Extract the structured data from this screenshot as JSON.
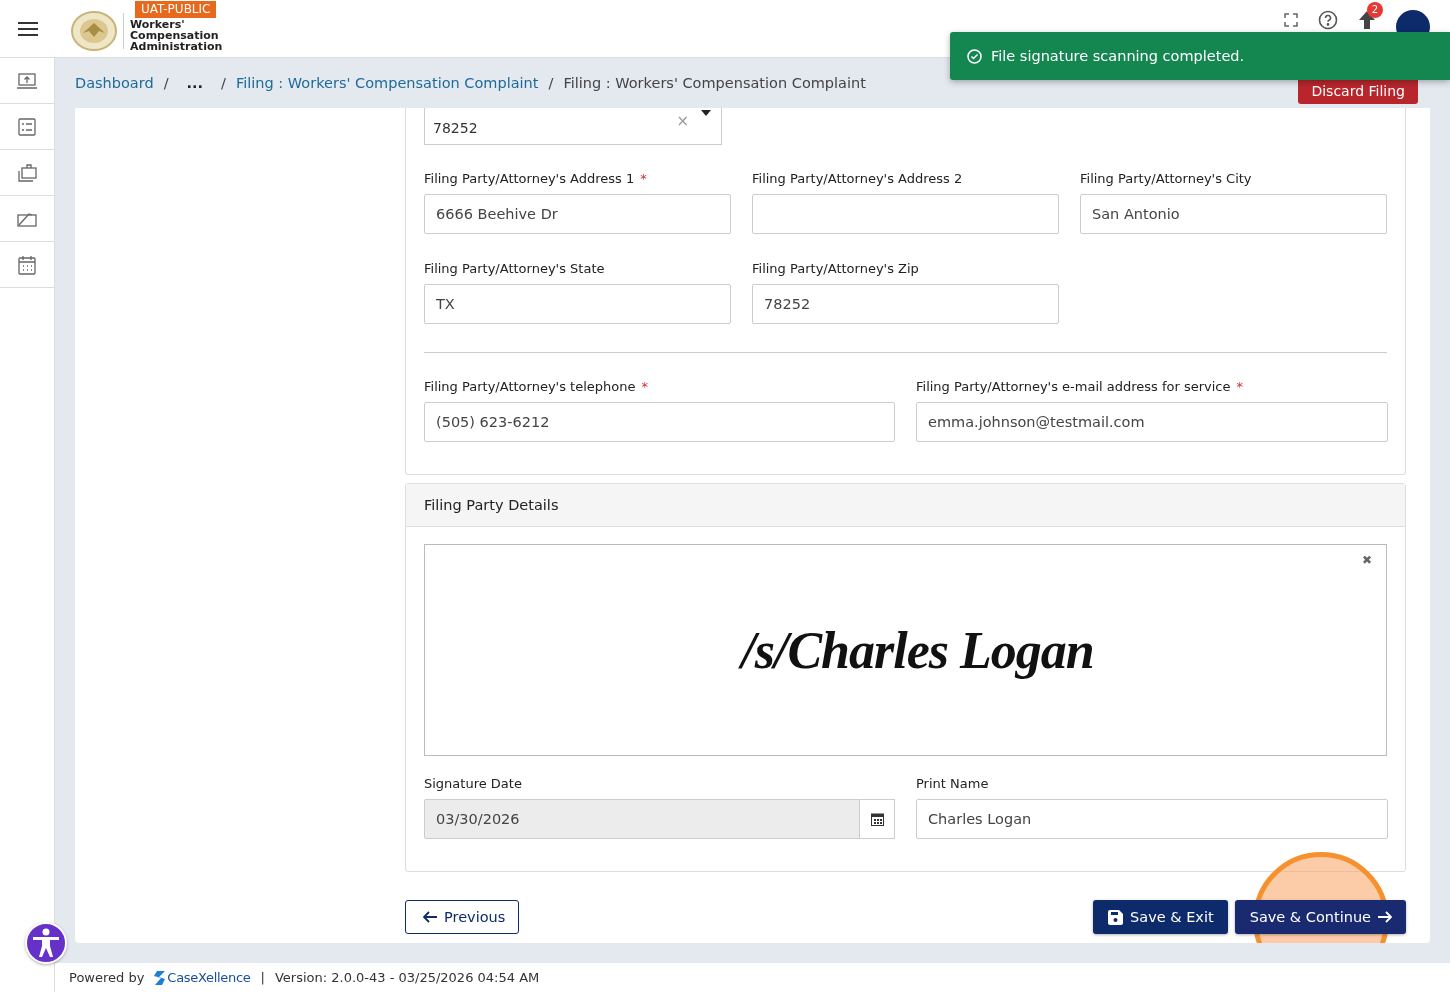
{
  "header": {
    "env_badge": "UAT-PUBLIC",
    "logo_lines": [
      "Workers'",
      "Compensation",
      "Administration"
    ],
    "notification_count": "2"
  },
  "sidebar": {
    "items": [
      {
        "kind": "upload"
      },
      {
        "kind": "list"
      },
      {
        "kind": "briefcase"
      },
      {
        "kind": "edit"
      },
      {
        "kind": "calendar"
      }
    ]
  },
  "breadcrumbs": [
    {
      "label": "Dashboard",
      "link": true
    },
    {
      "separator": "/",
      "label": "...",
      "link": false
    },
    {
      "separator": "/",
      "label": "Filing : Workers' Compensation Complaint",
      "link": true
    },
    {
      "separator": "/",
      "label": "Filing : Workers' Compensation Complaint",
      "link": false
    }
  ],
  "discard_button": "Discard Filing",
  "toast": {
    "message": "File signature scanning completed."
  },
  "address_select": {
    "value": "78252",
    "clear": "×"
  },
  "address_fields": [
    {
      "label": "Filing Party/Attorney's Address 1",
      "required_mark": "*",
      "value": "6666 Beehive Dr"
    },
    {
      "label": "Filing Party/Attorney's Address 2"
    },
    {
      "label": "Filing Party/Attorney's City",
      "value": "San Antonio"
    },
    {
      "label": "Filing Party/Attorney's State",
      "value": "TX"
    },
    {
      "label": "Filing Party/Attorney's Zip",
      "value": "78252"
    }
  ],
  "contact_fields": [
    {
      "label": "Filing Party/Attorney's telephone",
      "required_mark": "*",
      "value": "(505) 623-6212"
    },
    {
      "label": "Filing Party/Attorney's e-mail address for service",
      "required_mark": "*",
      "value": "emma.johnson@testmail.com"
    }
  ],
  "filing_party_details": {
    "title": "Filing Party Details",
    "signature": "/s/Charles Logan",
    "remove": "✖",
    "signature_date": {
      "label": "Signature Date",
      "value": "03/30/2026",
      "disabled": true
    },
    "print_name": {
      "label": "Print Name",
      "value": "Charles Logan"
    }
  },
  "buttons": {
    "previous": "Previous",
    "save_exit": "Save & Exit",
    "save_continue": "Save & Continue"
  },
  "footer": {
    "powered_by": "Powered by",
    "brand": "CaseXellence",
    "separator": "|",
    "version": "Version: 2.0.0-43 - 03/25/2026 04:54 AM"
  }
}
